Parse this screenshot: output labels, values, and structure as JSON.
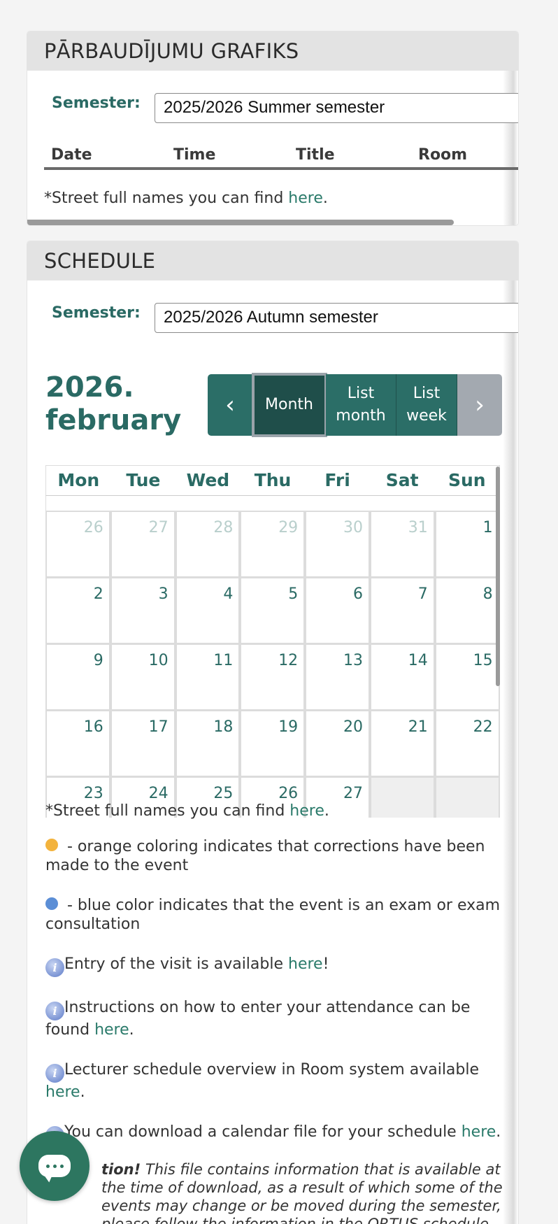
{
  "exam_panel": {
    "title": "PĀRBAUDĪJUMU GRAFIKS",
    "semester_label": "Semester:",
    "semester_value": "2025/2026 Summer semester",
    "columns": [
      "Date",
      "Time",
      "Title",
      "Room"
    ],
    "note_prefix": "*Street full names you can find ",
    "note_link": "here",
    "note_suffix": "."
  },
  "schedule_panel": {
    "title": "SCHEDULE",
    "semester_label": "Semester:",
    "semester_value": "2025/2026 Autumn semester",
    "month_year": "2026.",
    "month_name": "february",
    "buttons": {
      "prev": "‹",
      "month": "Month",
      "list_month_1": "List",
      "list_month_2": "month",
      "list_week_1": "List",
      "list_week_2": "week",
      "next": "›"
    },
    "weekdays": [
      "Mon",
      "Tue",
      "Wed",
      "Thu",
      "Fri",
      "Sat",
      "Sun"
    ],
    "weeks": [
      [
        "26",
        "27",
        "28",
        "29",
        "30",
        "31",
        "1"
      ],
      [
        "2",
        "3",
        "4",
        "5",
        "6",
        "7",
        "8"
      ],
      [
        "9",
        "10",
        "11",
        "12",
        "13",
        "14",
        "15"
      ],
      [
        "16",
        "17",
        "18",
        "19",
        "20",
        "21",
        "22"
      ],
      [
        "23",
        "24",
        "25",
        "26",
        "27",
        "",
        ""
      ]
    ]
  },
  "info": {
    "street_prefix": "*Street full names you can find ",
    "street_link": "here",
    "street_suffix": ".",
    "orange_text": " - orange coloring indicates that corrections have been made to the event",
    "blue_text": " - blue color indicates that the event is an exam or exam consultation",
    "entry_text": "Entry of the visit is available ",
    "entry_link": "here",
    "entry_suffix": "!",
    "instructions_text": "Instructions on how to enter your attendance can be found ",
    "instructions_link": "here",
    "instructions_suffix": ".",
    "lecturer_text": "Lecturer schedule overview in Room system available ",
    "lecturer_link": "here",
    "lecturer_suffix": ".",
    "download_text": "You can download a calendar file for your schedule ",
    "download_link": "here",
    "download_suffix": ".",
    "attention_bold": "tion!",
    "attention_text": " This file contains information that is available at the time of download, as a result of which some of the events may change or be moved during the semester, please follow the information in the ORTUS schedule section, where current"
  },
  "colors": {
    "accent": "#2a6a64",
    "orange": "#f3b33d",
    "blue": "#5b8ed6",
    "chat": "#2d7660"
  }
}
